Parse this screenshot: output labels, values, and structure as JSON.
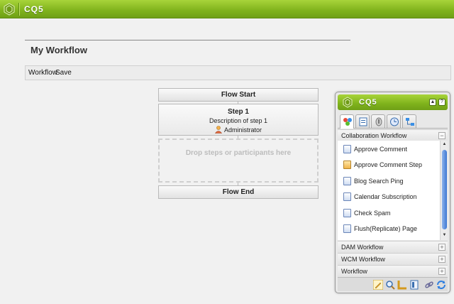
{
  "app": {
    "title": "CQ5"
  },
  "page": {
    "title": "My Workflow"
  },
  "toolbar": {
    "workflow_label": "Workflow",
    "save_label": "Save"
  },
  "flow": {
    "start_label": "Flow Start",
    "end_label": "Flow End",
    "step": {
      "title": "Step 1",
      "description": "Description of step 1",
      "participant": "Administrator"
    },
    "drop_zone_text": "Drop steps or participants here"
  },
  "sidekick": {
    "title": "CQ5",
    "active_group": "Collaboration Workflow",
    "items": [
      {
        "label": "Approve Comment",
        "icon": "document-icon"
      },
      {
        "label": "Approve Comment Step",
        "icon": "user-step-icon"
      },
      {
        "label": "Blog Search Ping",
        "icon": "document-icon"
      },
      {
        "label": "Calendar Subscription",
        "icon": "document-icon"
      },
      {
        "label": "Check Spam",
        "icon": "document-icon"
      },
      {
        "label": "Flush(Replicate) Page",
        "icon": "document-icon"
      }
    ],
    "groups": [
      {
        "label": "DAM Workflow"
      },
      {
        "label": "WCM Workflow"
      },
      {
        "label": "Workflow"
      }
    ],
    "collapse_symbol": "−",
    "expand_symbol": "+"
  },
  "colors": {
    "brand_green": "#7fb21c",
    "scroll_blue": "#3e78d3"
  }
}
